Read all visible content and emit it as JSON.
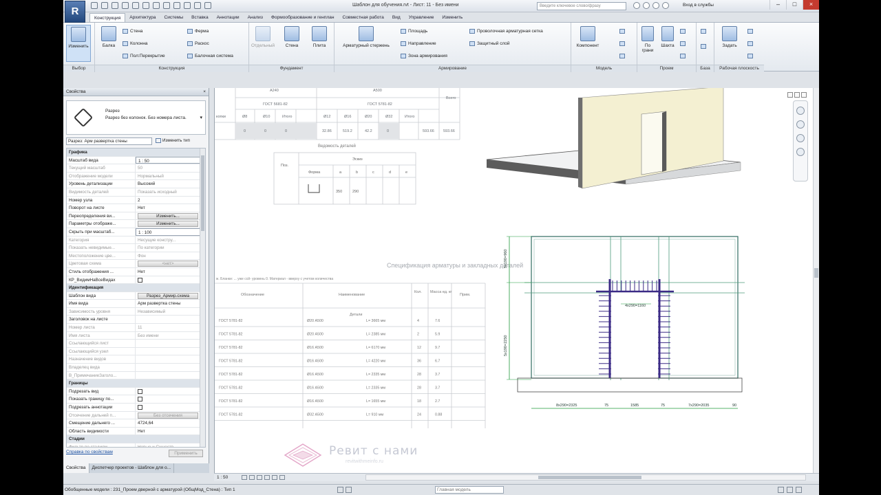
{
  "app": {
    "title": "Шаблон для обучения.rvt - Лист: 11 - Без имени",
    "logo": "R",
    "search_placeholder": "Введите ключевое слово/фразу",
    "login": "Вход в службы",
    "tabs": [
      "Конструкция",
      "Архитектура",
      "Системы",
      "Вставка",
      "Аннотации",
      "Анализ",
      "Формообразование и генплан",
      "Совместная работа",
      "Вид",
      "Управление",
      "Изменить"
    ],
    "active_tab": "Конструкция"
  },
  "ribbon": {
    "modify": "Изменить",
    "beam": "Балка",
    "wall": "Стена",
    "column": "Колонна",
    "floor": "Пол:Перекрытие",
    "truss": "Ферма",
    "brace": "Раскос",
    "beam_system": "Балочная система",
    "isolated": "Отдельный",
    "found_wall": "Стена",
    "slab": "Плита",
    "rebar": "Арматурный стержень",
    "area": "Площадь",
    "path": "Направление",
    "rebar_zone": "Зона армирования",
    "fabric_sheet": "Проволочная арматурная сетка",
    "cover": "Защитный слой",
    "component": "Компонент",
    "by_face": "По грани",
    "shaft": "Шахта",
    "set": "Задать",
    "panels": {
      "select": "Выбор",
      "structure": "Конструкция",
      "foundation": "Фундамент",
      "reinforcement": "Армирование",
      "model": "Модель",
      "opening": "Проем",
      "datum": "База",
      "workplane": "Рабочая плоскость"
    }
  },
  "properties": {
    "header": "Свойства",
    "type_name": "Разрез",
    "type_desc": "Разрез без колонок. Без номера листа.",
    "instance_selector": "Разрез: Арм развертка стены",
    "edit_type": "Изменить тип",
    "rows": [
      {
        "n": "Графика",
        "g": true
      },
      {
        "n": "Масштаб вида",
        "v": "1 : 50",
        "box": true
      },
      {
        "n": "Текущий масштаб",
        "v": "50",
        "gray": true
      },
      {
        "n": "Отображение модели",
        "v": "Нормальный",
        "gray": true
      },
      {
        "n": "Уровень детализации",
        "v": "Высокий"
      },
      {
        "n": "Видимость деталей",
        "v": "Показать исходный",
        "gray": true
      },
      {
        "n": "Номер узла",
        "v": "2"
      },
      {
        "n": "Поворот на листе",
        "v": "Нет"
      },
      {
        "n": "Переопределения ви...",
        "b": "Изменить..."
      },
      {
        "n": "Параметры отображе...",
        "b": "Изменить..."
      },
      {
        "n": "Скрыть при масштаб...",
        "v": "1 : 100",
        "box": true
      },
      {
        "n": "Категория",
        "v": "Несущие констру...",
        "gray": true
      },
      {
        "n": "Показать невидимые...",
        "v": "По категории",
        "gray": true
      },
      {
        "n": "Местоположение цве...",
        "v": "Фон",
        "gray": true
      },
      {
        "n": "Цветовая схема",
        "b": "<нет>",
        "gray": true
      },
      {
        "n": "Стиль отображения ...",
        "v": "Нет"
      },
      {
        "n": "КР_ВидимНаВсеВидах",
        "c": true
      },
      {
        "n": "Идентификация",
        "g": true
      },
      {
        "n": "Шаблон вида",
        "b": "Разрез_Армир.схема"
      },
      {
        "n": "Имя вида",
        "v": "Арм развертка стены"
      },
      {
        "n": "Зависимость уровня",
        "v": "Независимый",
        "gray": true
      },
      {
        "n": "Заголовок на листе",
        "v": ""
      },
      {
        "n": "Номер листа",
        "v": "11",
        "gray": true
      },
      {
        "n": "Имя листа",
        "v": "Без имени",
        "gray": true
      },
      {
        "n": "Ссылающийся лист",
        "v": "",
        "gray": true
      },
      {
        "n": "Ссылающийся узел",
        "v": "",
        "gray": true
      },
      {
        "n": "Назначение видов",
        "v": "",
        "gray": true
      },
      {
        "n": "Владелец вида",
        "v": "",
        "gray": true
      },
      {
        "n": "В_ПримечаниеЗаголо...",
        "v": "",
        "gray": true
      },
      {
        "n": "Границы",
        "g": true
      },
      {
        "n": "Подрезать вид",
        "c": true
      },
      {
        "n": "Показать границу по...",
        "c": true
      },
      {
        "n": "Подрезать аннотации",
        "c": true
      },
      {
        "n": "Отсечение дальней п...",
        "b": "Без отсечения",
        "gray": true
      },
      {
        "n": "Смещение дальнего ...",
        "v": "4724,64"
      },
      {
        "n": "Область видимости",
        "v": "Нет"
      },
      {
        "n": "Стадии",
        "g": true
      },
      {
        "n": "Фильтр по стадиям",
        "v": "Новые и Существ...",
        "gray": true
      },
      {
        "n": "Стадия",
        "v": "Новая",
        "gray": true
      }
    ],
    "help": "Справка по свойствам",
    "apply": "Применить",
    "tabs": [
      "Свойства",
      "Диспетчер проектов - Шаблон для о..."
    ]
  },
  "schedule_top": {
    "h1": "А240",
    "h2": "А500",
    "total": "Всего",
    "gost1": "ГОСТ 5681-82",
    "gost2": "ГОСТ 5781-82",
    "row_label": "копки",
    "cols": [
      "Ø8",
      "Ø10",
      "Итого",
      "Ø12",
      "Ø16",
      "Ø20",
      "Ø32",
      "Итого"
    ],
    "vals": [
      "0",
      "0",
      "0",
      "32.86",
      "519.2",
      "42.2",
      "0",
      "593.66",
      "593.66"
    ]
  },
  "shapes": {
    "title": "Ведомость деталей",
    "pos": "Поз.",
    "sketch": "Эскиз",
    "shape": "Форма",
    "cols": [
      "a",
      "b",
      "c",
      "d",
      "e"
    ],
    "vals": [
      "350",
      "290"
    ]
  },
  "spec": {
    "title": "Спецификация арматуры и закладных деталей",
    "subtitle": "ж. Бланки: ... уже ссй- уровень 0. Материал - вверху с учетом количества",
    "headers": [
      "Обозначение",
      "Наименование",
      "Кол.",
      "Масса ед. кг",
      "Прим."
    ],
    "section": "Детали",
    "rows": [
      [
        "ГОСТ 5781-82",
        "Ø20 А500",
        "L= 3665 мм",
        "4",
        "7.6"
      ],
      [
        "ГОСТ 5781-82",
        "Ø20 А500",
        "L= 2385 мм",
        "2",
        "5.9"
      ],
      [
        "ГОСТ 5781-82",
        "Ø16 А500",
        "L= 6170 мм",
        "12",
        "9.7"
      ],
      [
        "ГОСТ 5781-82",
        "Ø16 А500",
        "L= 4220 мм",
        "36",
        "6.7"
      ],
      [
        "ГОСТ 5781-82",
        "Ø16 А500",
        "L= 2335 мм",
        "28",
        "3.7"
      ],
      [
        "ГОСТ 5781-82",
        "Ø16 А500",
        "L= 2335 мм",
        "28",
        "3.7"
      ],
      [
        "ГОСТ 5781-82",
        "Ø16 А500",
        "L= 1655 мм",
        "18",
        "2.7"
      ],
      [
        "ГОСТ 5781-82",
        "Ø32 А500",
        "L= 910 мм",
        "24",
        "0.88"
      ]
    ]
  },
  "elevation": {
    "dim_top": "4х290=1160",
    "dim_left1": "5х190=960",
    "dim_left2": "5х190=2250",
    "dim_bottom": [
      "8х290=2325",
      "75",
      "1585",
      "75",
      "7х290=2035",
      "90"
    ],
    "tag": "Х",
    "dim_left3": "5х190=2910"
  },
  "watermark": {
    "line1": "Ревит с нами",
    "line2": "revitwithmeinfo.ru"
  },
  "view_bar": {
    "scale": "1 : 50"
  },
  "status": {
    "text": "Обобщенные модели : 231_Проем дверной с арматурой (ОбщМод_Стена) : Тип 1",
    "model": "Главная модель"
  },
  "colors": {
    "wall_face": "#f4f0d2",
    "rebar": "#3b2b86",
    "grid": "#3e8b66",
    "accent": "#2a5aa0"
  }
}
